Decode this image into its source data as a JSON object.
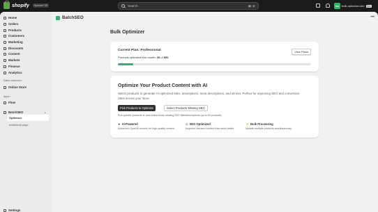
{
  "topbar": {
    "logo_text": "shopify",
    "edition_badge": "Summer '25",
    "search_placeholder": "Search",
    "shortcut_mod": "⌘",
    "shortcut_key": "K",
    "account_initials": "bo",
    "store_name": "bulk-optimizer-dev",
    "store_badge": "Dev"
  },
  "sidebar": {
    "items": [
      {
        "label": "Home",
        "icon": "home-icon"
      },
      {
        "label": "Orders",
        "icon": "orders-icon"
      },
      {
        "label": "Products",
        "icon": "tag-icon"
      },
      {
        "label": "Customers",
        "icon": "person-icon"
      },
      {
        "label": "Marketing",
        "icon": "target-icon"
      },
      {
        "label": "Discounts",
        "icon": "discount-icon"
      },
      {
        "label": "Content",
        "icon": "content-icon"
      },
      {
        "label": "Markets",
        "icon": "globe-icon"
      },
      {
        "label": "Finance",
        "icon": "bank-icon"
      },
      {
        "label": "Analytics",
        "icon": "chart-icon"
      }
    ],
    "sales_channels_label": "Sales channels",
    "online_store": "Online Store",
    "apps_label": "Apps",
    "flow": "Flow",
    "app_name": "BatchSEO",
    "app_sub_active": "Optimizer",
    "app_sub_other": "Additional page",
    "settings": "Settings"
  },
  "main": {
    "app_title": "BatchSEO",
    "page_title": "Bulk Optimizer",
    "plan": {
      "title": "Current Plan: Professional",
      "view_plans": "View Plans",
      "usage_prefix": "Products optimized this month: ",
      "usage_used": "39",
      "usage_of": " of ",
      "usage_total": "500",
      "fraction": 0.078
    },
    "optimize": {
      "title": "Optimize Your Product Content with AI",
      "description": "Select products to generate AI-optimized titles, descriptions, meta descriptions, and alt text. Perfect for improving SEO and conversion rates across your store.",
      "primary_button": "Pick Products to Optimize",
      "secondary_button": "Select Products Missing SEO",
      "hint": "Pick specific products or auto-select those missing SEO titles/descriptions (up to 50 products)",
      "features": [
        {
          "icon": "★",
          "title": "AI-Powered",
          "desc": "Advanced OpenAI models for high-quality content"
        },
        {
          "icon": "◎",
          "title": "SEO Optimized",
          "desc": "Keyword-focused content that ranks better"
        },
        {
          "icon": "⚡",
          "title": "Bulk Processing",
          "desc": "Update multiple products simultaneously"
        }
      ]
    }
  },
  "colors": {
    "accent_green": "#29b764",
    "topbar": "#1a1a1a",
    "sidebar": "#ebebeb",
    "main_bg": "#f1f1f1"
  }
}
